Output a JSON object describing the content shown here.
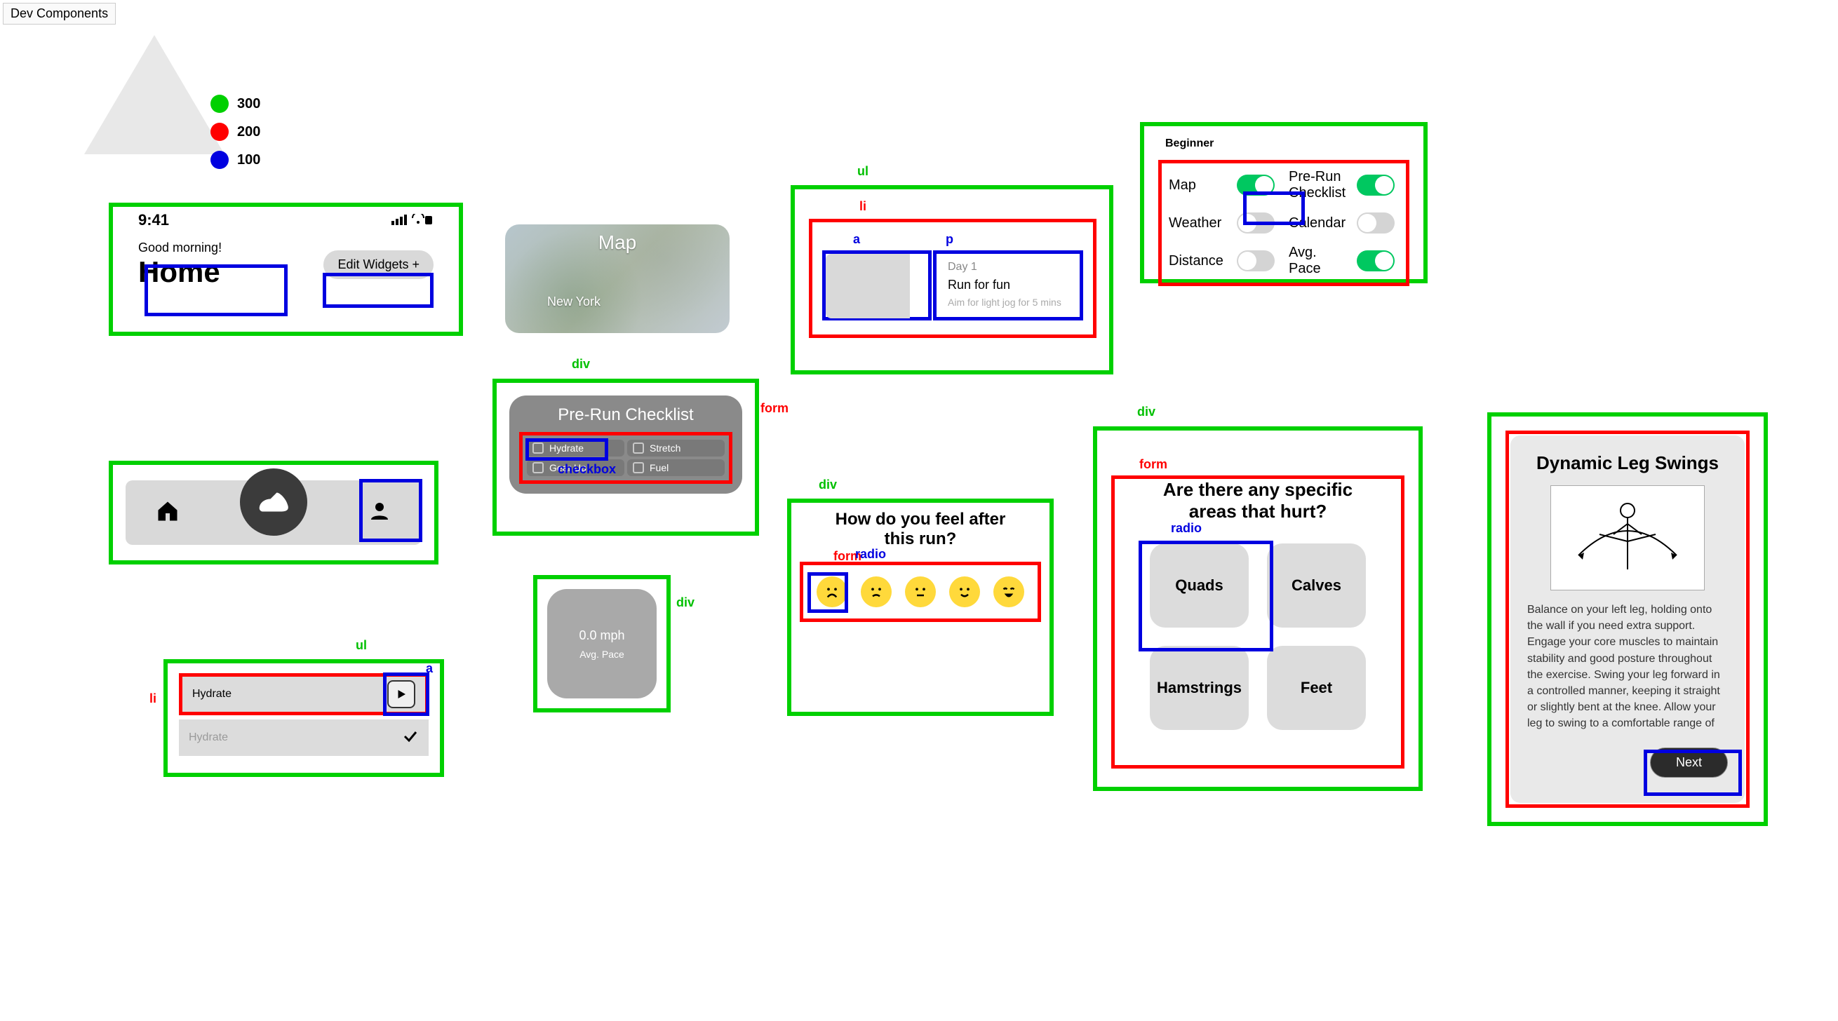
{
  "dev_button": "Dev Components",
  "legend": {
    "g": "300",
    "r": "200",
    "b": "100"
  },
  "colors": {
    "green": "#00d000",
    "red": "#ff0000",
    "blue": "#0000e0"
  },
  "labels": {
    "ul": "ul",
    "li": "li",
    "a": "a",
    "p": "p",
    "div": "div",
    "form": "form",
    "radio": "radio",
    "checkbox": "checkbox"
  },
  "home": {
    "time": "9:41",
    "greeting": "Good morning!",
    "title": "Home",
    "edit": "Edit Widgets +"
  },
  "map": {
    "title": "Map",
    "city": "New York"
  },
  "training": {
    "day": "Day 1",
    "title": "Run for fun",
    "sub": "Aim for light jog for 5 mins"
  },
  "beginner": {
    "title": "Beginner",
    "rows": [
      {
        "l": "Map",
        "lon": true,
        "r": "Pre-Run Checklist",
        "ron": true
      },
      {
        "l": "Weather",
        "lon": false,
        "r": "Calendar",
        "ron": false
      },
      {
        "l": "Distance",
        "lon": false,
        "r": "Avg. Pace",
        "ron": true
      }
    ]
  },
  "checklist": {
    "title": "Pre-Run Checklist",
    "items": [
      "Hydrate",
      "Stretch",
      "Gear Up",
      "Fuel"
    ]
  },
  "pace": {
    "value": "0.0 mph",
    "label": "Avg. Pace"
  },
  "hydrate": {
    "pending": "Hydrate",
    "done": "Hydrate"
  },
  "feel": {
    "question": "How do you feel after this run?",
    "faces": [
      "sad",
      "frown",
      "meh",
      "smile",
      "grin"
    ]
  },
  "hurt": {
    "question": "Are there any specific areas that hurt?",
    "options": [
      "Quads",
      "Calves",
      "Hamstrings",
      "Feet"
    ]
  },
  "exercise": {
    "title": "Dynamic Leg Swings",
    "desc": "Balance on your left leg, holding onto the wall if you need extra support. Engage your core muscles to maintain stability and good posture throughout the exercise. Swing your leg forward in a controlled manner, keeping it straight or slightly bent at the knee. Allow your leg to swing to a comfortable range of motion.",
    "next": "Next"
  }
}
